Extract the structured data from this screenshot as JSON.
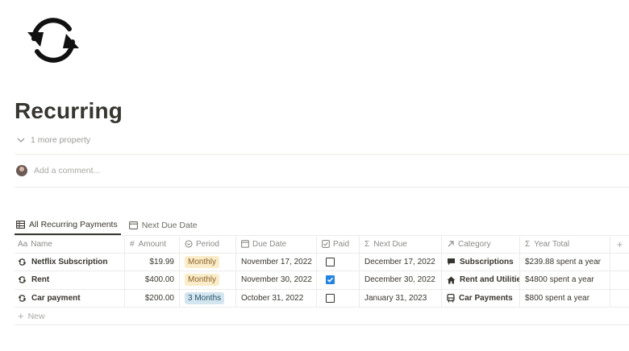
{
  "page": {
    "icon": "sync-arrows-icon",
    "title": "Recurring",
    "more_property": "1 more property",
    "comment_placeholder": "Add a comment..."
  },
  "tabs": [
    {
      "label": "All Recurring Payments",
      "icon": "table-icon",
      "active": true
    },
    {
      "label": "Next Due Date",
      "icon": "calendar-icon",
      "active": false
    }
  ],
  "table": {
    "headers": {
      "name": "Name",
      "amount": "Amount",
      "period": "Period",
      "due": "Due Date",
      "paid": "Paid",
      "next": "Next Due",
      "category": "Category",
      "year": "Year Total",
      "add": "+"
    },
    "rows": [
      {
        "name": "Netflix Subscription",
        "amount": "$19.99",
        "period": "Monthly",
        "due": "November 17, 2022",
        "paid": false,
        "next": "December 17, 2022",
        "category": "Subscriptions",
        "category_icon": "chat-bubble-icon",
        "year": "$239.88 spent a year"
      },
      {
        "name": "Rent",
        "amount": "$400.00",
        "period": "Monthly",
        "due": "November 30, 2022",
        "paid": true,
        "next": "December 30, 2022",
        "category": "Rent and Utilities",
        "category_icon": "house-icon",
        "year": "$4800 spent a year"
      },
      {
        "name": "Car payment",
        "amount": "$200.00",
        "period": "3 Months",
        "due": "October 31, 2022",
        "paid": false,
        "next": "January 31, 2023",
        "category": "Car Payments",
        "category_icon": "bus-icon",
        "year": "$800 spent a year"
      }
    ],
    "new_label": "New"
  },
  "colors": {
    "text": "#37352f",
    "muted": "#9b9a97",
    "checkbox_checked": "#2383e2",
    "tag_monthly_bg": "#fbecc9",
    "tag_3months_bg": "#d3e5ef"
  }
}
